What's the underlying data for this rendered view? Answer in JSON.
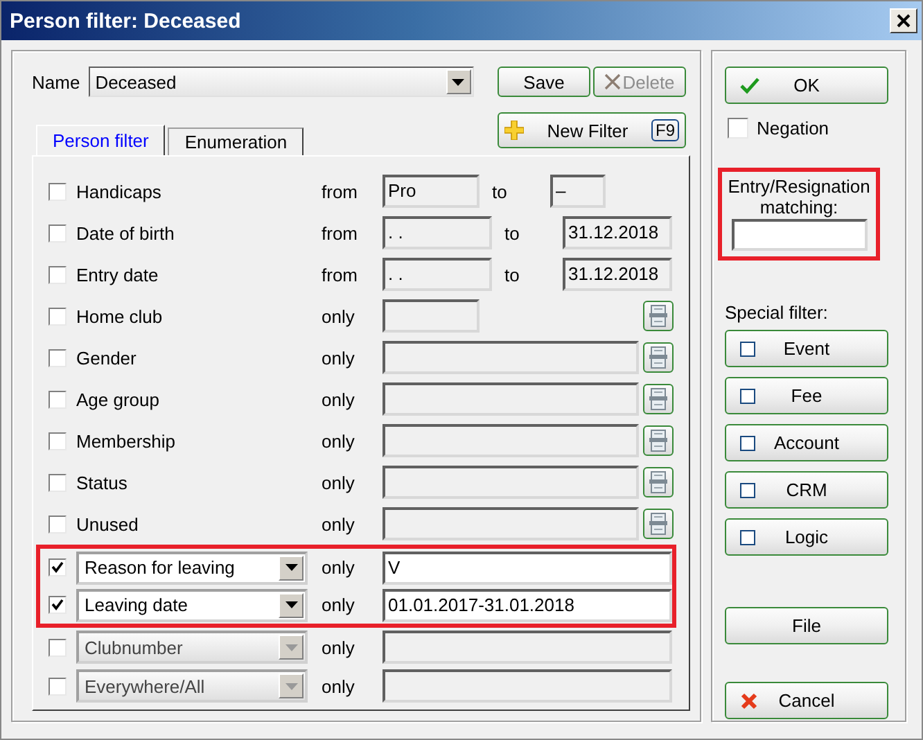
{
  "window": {
    "title": "Person filter: Deceased"
  },
  "name_field": {
    "label": "Name",
    "value": "Deceased"
  },
  "top_buttons": [
    {
      "label": "Save",
      "enabled": true,
      "kind": "save"
    },
    {
      "label": "Delete",
      "enabled": false,
      "kind": "delete"
    }
  ],
  "new_filter": {
    "label": "New Filter",
    "shortcut": "F9"
  },
  "tabs": [
    {
      "label": "Person filter",
      "selected": true
    },
    {
      "label": "Enumeration",
      "selected": false
    }
  ],
  "rows": [
    {
      "kind": "short_range",
      "label": "Handicaps",
      "checked": false,
      "highlighted": false,
      "from_word": "from",
      "from_value": "Pro",
      "to_word": "to",
      "to_value": "–"
    },
    {
      "kind": "range",
      "label": "Date of birth",
      "checked": false,
      "highlighted": false,
      "from_word": "from",
      "from_value": ". .",
      "to_word": "to",
      "to_value": "31.12.2018"
    },
    {
      "kind": "range",
      "label": "Entry date",
      "checked": false,
      "highlighted": false,
      "from_word": "from",
      "from_value": ". .",
      "to_word": "to",
      "to_value": "31.12.2018"
    },
    {
      "kind": "short_pick",
      "label": "Home club",
      "checked": false,
      "highlighted": false,
      "word": "only"
    },
    {
      "kind": "pick",
      "label": "Gender",
      "checked": false,
      "highlighted": false,
      "word": "only"
    },
    {
      "kind": "pick",
      "label": "Age group",
      "checked": false,
      "highlighted": false,
      "word": "only"
    },
    {
      "kind": "pick",
      "label": "Membership",
      "checked": false,
      "highlighted": false,
      "word": "only"
    },
    {
      "kind": "pick",
      "label": "Status",
      "checked": false,
      "highlighted": false,
      "word": "only"
    },
    {
      "kind": "pick",
      "label": "Unused",
      "checked": false,
      "highlighted": false,
      "word": "only"
    },
    {
      "kind": "select",
      "label": "Reason for leaving",
      "checked": true,
      "highlighted": true,
      "enabled": true,
      "word": "only",
      "value": "V"
    },
    {
      "kind": "select",
      "label": "Leaving date",
      "checked": true,
      "highlighted": true,
      "enabled": true,
      "word": "only",
      "value": "01.01.2017-31.01.2018"
    },
    {
      "kind": "select",
      "label": "Clubnumber",
      "checked": false,
      "highlighted": false,
      "enabled": false,
      "word": "only"
    },
    {
      "kind": "select",
      "label": "Everywhere/All",
      "checked": false,
      "highlighted": false,
      "enabled": false,
      "word": "only"
    }
  ],
  "ok_button": {
    "label": "OK"
  },
  "negation": {
    "label": "Negation",
    "checked": false
  },
  "entry_matching": {
    "label": "Entry/Resignation matching:",
    "highlighted": true
  },
  "special_filter": {
    "label": "Special filter:",
    "items": [
      {
        "label": "Event",
        "checked": false
      },
      {
        "label": "Fee",
        "checked": false
      },
      {
        "label": "Account",
        "checked": false
      },
      {
        "label": "CRM",
        "checked": false
      },
      {
        "label": "Logic",
        "checked": false
      }
    ]
  },
  "file_button": {
    "label": "File"
  },
  "cancel_button": {
    "label": "Cancel"
  }
}
